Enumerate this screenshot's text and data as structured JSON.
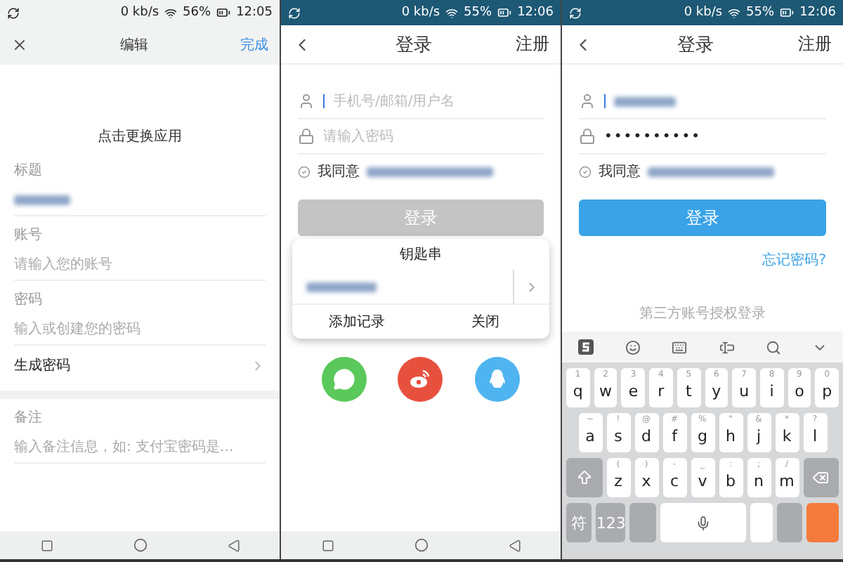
{
  "screens": [
    {
      "kind": "edit",
      "status_bar": {
        "kind": "light",
        "speed": "0 kb/s",
        "battery": "56%",
        "time": "12:05"
      },
      "header": {
        "title": "编辑",
        "action": "完成"
      },
      "app_hint": "点击更换应用",
      "fields": [
        {
          "label": "标题",
          "kind": "blurred"
        },
        {
          "label": "账号",
          "kind": "placeholder",
          "placeholder": "请输入您的账号"
        },
        {
          "label": "密码",
          "kind": "placeholder",
          "placeholder": "输入或创建您的密码"
        }
      ],
      "generate_row": "生成密码",
      "note": {
        "label": "备注",
        "placeholder": "输入备注信息，如: 支付宝密码是..."
      }
    },
    {
      "kind": "login",
      "status_bar": {
        "kind": "dark",
        "speed": "0 kb/s",
        "battery": "55%",
        "time": "12:06"
      },
      "header": {
        "title": "登录",
        "action": "注册"
      },
      "username": {
        "kind": "placeholder",
        "placeholder": "手机号/邮箱/用户名",
        "focused": true
      },
      "password": {
        "kind": "placeholder",
        "placeholder": "请输入密码"
      },
      "agreement": "我同意",
      "login_button": {
        "label": "登录",
        "disabled": true
      },
      "keychain_popup": {
        "title": "钥匙串",
        "buttons": [
          "添加记录",
          "关闭"
        ]
      },
      "social": [
        {
          "kind": "chat",
          "color": "#5ac85a"
        },
        {
          "kind": "swirl",
          "color": "#e8503e"
        },
        {
          "kind": "penguin",
          "color": "#4fb4f0"
        }
      ]
    },
    {
      "kind": "login",
      "status_bar": {
        "kind": "dark",
        "speed": "0 kb/s",
        "battery": "55%",
        "time": "12:06"
      },
      "header": {
        "title": "登录",
        "action": "注册"
      },
      "username": {
        "kind": "blurred",
        "focused": true
      },
      "password": {
        "kind": "value",
        "value": "••••••••••"
      },
      "agreement": "我同意",
      "login_button": {
        "label": "登录",
        "disabled": false
      },
      "forgot_link": "忘记密码?",
      "third_party_label": "第三方账号授权登录",
      "keyboard": {
        "rows": [
          [
            {
              "kind": "char",
              "label": "q",
              "hint": "1"
            },
            {
              "kind": "char",
              "label": "w",
              "hint": "2"
            },
            {
              "kind": "char",
              "label": "e",
              "hint": "3"
            },
            {
              "kind": "char",
              "label": "r",
              "hint": "4"
            },
            {
              "kind": "char",
              "label": "t",
              "hint": "5"
            },
            {
              "kind": "char",
              "label": "y",
              "hint": "6"
            },
            {
              "kind": "char",
              "label": "u",
              "hint": "7"
            },
            {
              "kind": "char",
              "label": "i",
              "hint": "8"
            },
            {
              "kind": "char",
              "label": "o",
              "hint": "9"
            },
            {
              "kind": "char",
              "label": "p",
              "hint": "0"
            }
          ],
          [
            {
              "kind": "char",
              "label": "a",
              "hint": "~"
            },
            {
              "kind": "char",
              "label": "s",
              "hint": "!"
            },
            {
              "kind": "char",
              "label": "d",
              "hint": "@"
            },
            {
              "kind": "char",
              "label": "f",
              "hint": "#"
            },
            {
              "kind": "char",
              "label": "g",
              "hint": "%"
            },
            {
              "kind": "char",
              "label": "h",
              "hint": "\""
            },
            {
              "kind": "char",
              "label": "j",
              "hint": "&"
            },
            {
              "kind": "char",
              "label": "k",
              "hint": "*"
            },
            {
              "kind": "char",
              "label": "l",
              "hint": "?"
            }
          ],
          [
            {
              "kind": "shift"
            },
            {
              "kind": "char",
              "label": "z",
              "hint": "("
            },
            {
              "kind": "char",
              "label": "x",
              "hint": ")"
            },
            {
              "kind": "char",
              "label": "c",
              "hint": "-"
            },
            {
              "kind": "char",
              "label": "v",
              "hint": "_"
            },
            {
              "kind": "char",
              "label": "b",
              "hint": ":"
            },
            {
              "kind": "char",
              "label": "n",
              "hint": ";"
            },
            {
              "kind": "char",
              "label": "m",
              "hint": "/"
            },
            {
              "kind": "backspace"
            }
          ],
          [
            {
              "kind": "func",
              "label": "符"
            },
            {
              "kind": "func",
              "label": "123"
            },
            {
              "kind": "func"
            },
            {
              "kind": "space"
            },
            {
              "kind": "char"
            },
            {
              "kind": "func"
            },
            {
              "kind": "enter"
            }
          ]
        ]
      }
    }
  ]
}
